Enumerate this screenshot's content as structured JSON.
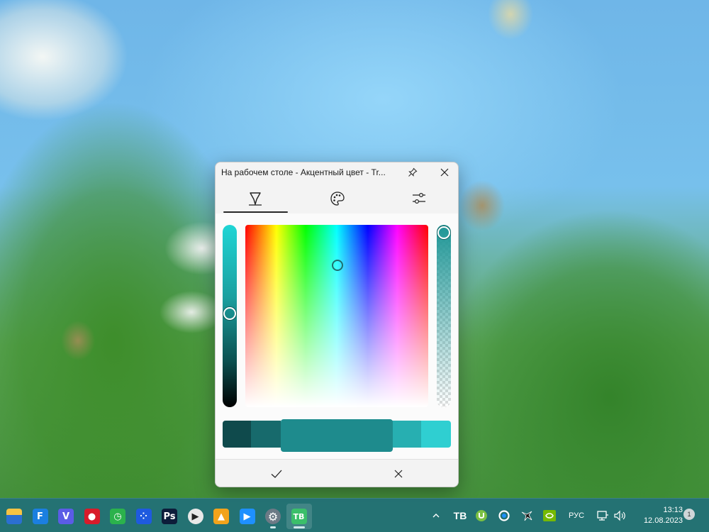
{
  "dialog": {
    "title": "На рабочем столе - Акцентный цвет - Tr...",
    "tabs": [
      {
        "icon": "pen-icon",
        "selected": true
      },
      {
        "icon": "palette-icon",
        "selected": false
      },
      {
        "icon": "sliders-icon",
        "selected": false
      }
    ],
    "hue_slider_value": 0.45,
    "alpha_slider_value": 1.0,
    "spectrum_color": "#1e9696",
    "swatches": [
      "#0f4a4c",
      "#176a6c",
      "#1e8b8d",
      "#27afb1",
      "#2fcfd1"
    ],
    "footer": {
      "ok_icon": "checkmark-icon",
      "cancel_icon": "close-icon"
    }
  },
  "taskbar": {
    "apps": [
      {
        "name": "file-explorer-app",
        "color": "#2b6fd1"
      },
      {
        "name": "f-app",
        "color": "#1b7fe0",
        "glyph": "F"
      },
      {
        "name": "v-app",
        "color": "#5b5ce6",
        "glyph": "V"
      },
      {
        "name": "record-app",
        "color": "#d81b2a",
        "glyph": "●"
      },
      {
        "name": "clock-app",
        "color": "#2bb24c",
        "glyph": "◷"
      },
      {
        "name": "dots-app",
        "color": "#1e5adf",
        "glyph": "⁘"
      },
      {
        "name": "photoshop-app",
        "color": "#0d1d3a",
        "glyph": "Ps"
      },
      {
        "name": "play-circle-app",
        "color": "#e8e8e8",
        "glyph": "▶"
      },
      {
        "name": "triangle-app",
        "color": "#f2a31b",
        "glyph": "▲"
      },
      {
        "name": "play-app",
        "color": "#1e90ff",
        "glyph": "▶"
      },
      {
        "name": "settings-app",
        "color": "#6c7a86",
        "glyph": "⚙"
      },
      {
        "name": "translucenttb-app",
        "color": "#3bbf6a",
        "glyph": "TB"
      }
    ],
    "tray": {
      "language": "РУС",
      "time": "13:13",
      "date": "12.08.2023",
      "notifications": "1"
    }
  }
}
